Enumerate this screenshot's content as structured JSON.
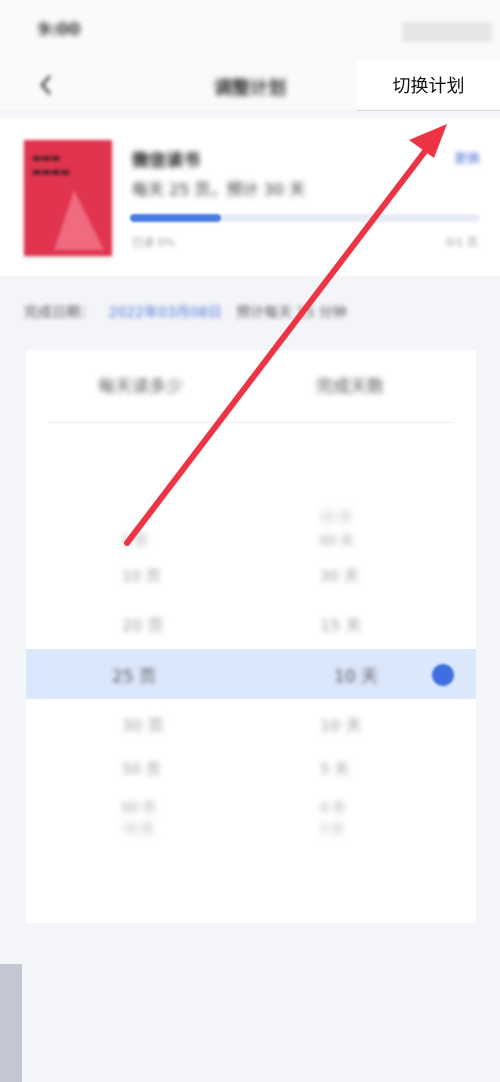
{
  "status_bar": {
    "time": "9:00"
  },
  "header": {
    "title": "调整计划",
    "switch_plan": "切换计划"
  },
  "book": {
    "title": "微信读书",
    "plan": "每天 25 页，预计 30 天",
    "change": "更换",
    "progress_fraction": 0.26,
    "progress_left": "已读 0%",
    "progress_right": "0/1 页"
  },
  "plan_date": {
    "label": "完成日期：",
    "date": "2022年03月08日",
    "note": "预计每天 15 分钟"
  },
  "picker": {
    "col_left": "每天读多少",
    "col_right": "完成天数",
    "rows": [
      {
        "left": "",
        "right": "15 天"
      },
      {
        "left": "5 页",
        "right": "60 天"
      },
      {
        "left": "10 页",
        "right": "30 天"
      },
      {
        "left": "20 页",
        "right": "15 天"
      },
      {
        "left": "25 页",
        "right": "10 天"
      },
      {
        "left": "30 页",
        "right": "10 天"
      },
      {
        "left": "50 页",
        "right": "5 天"
      },
      {
        "left": "60 页",
        "right": "4 天"
      },
      {
        "left": "70 页",
        "right": "3 天"
      }
    ],
    "selected": {
      "left": "25 页",
      "right": "10 天"
    }
  },
  "colors": {
    "accent": "#3f6ee0",
    "arrow": "#ec3445",
    "cover": "#e0344f"
  }
}
